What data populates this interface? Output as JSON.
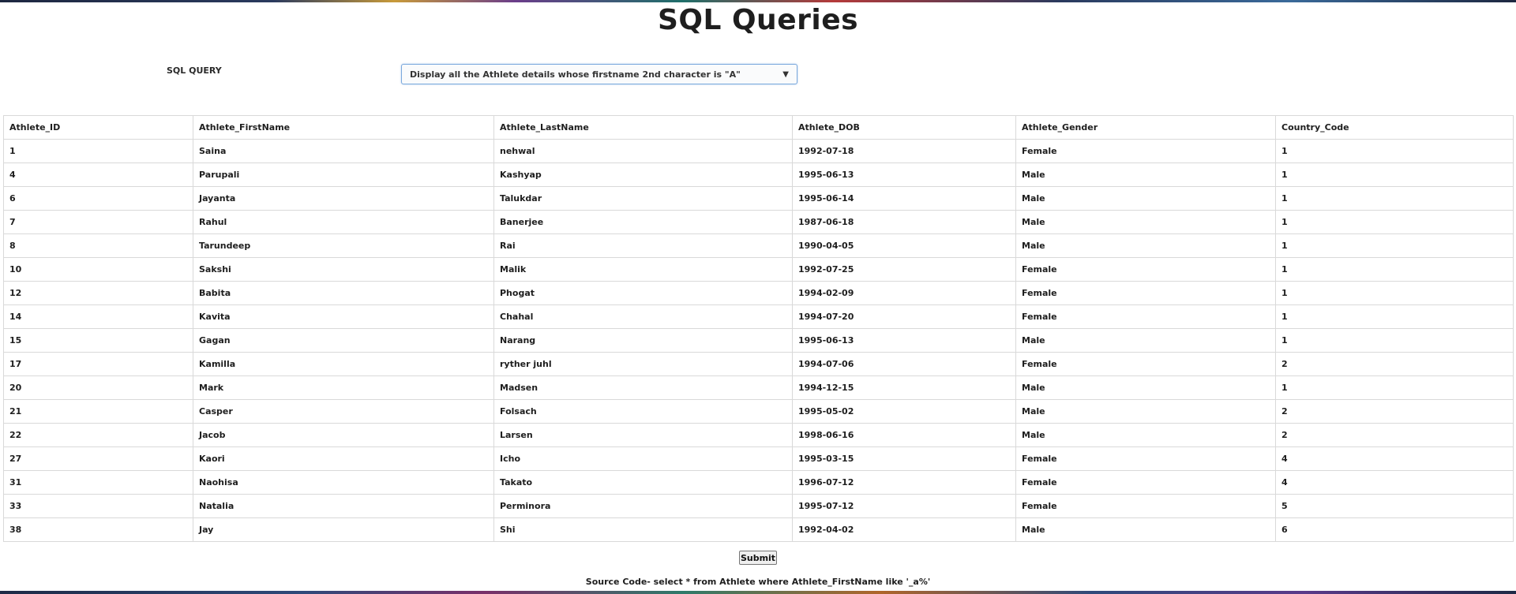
{
  "page": {
    "title": "SQL Queries"
  },
  "query": {
    "label": "SQL QUERY",
    "selected": "Display all the Athlete details whose firstname 2nd character is \"A\""
  },
  "table": {
    "columns": [
      "Athlete_ID",
      "Athlete_FirstName",
      "Athlete_LastName",
      "Athlete_DOB",
      "Athlete_Gender",
      "Country_Code"
    ],
    "rows": [
      [
        "1",
        "Saina",
        "nehwal",
        "1992-07-18",
        "Female",
        "1"
      ],
      [
        "4",
        "Parupali",
        "Kashyap",
        "1995-06-13",
        "Male",
        "1"
      ],
      [
        "6",
        "Jayanta",
        "Talukdar",
        "1995-06-14",
        "Male",
        "1"
      ],
      [
        "7",
        "Rahul",
        "Banerjee",
        "1987-06-18",
        "Male",
        "1"
      ],
      [
        "8",
        "Tarundeep",
        "Rai",
        "1990-04-05",
        "Male",
        "1"
      ],
      [
        "10",
        "Sakshi",
        "Malik",
        "1992-07-25",
        "Female",
        "1"
      ],
      [
        "12",
        "Babita",
        "Phogat",
        "1994-02-09",
        "Female",
        "1"
      ],
      [
        "14",
        "Kavita",
        "Chahal",
        "1994-07-20",
        "Female",
        "1"
      ],
      [
        "15",
        "Gagan",
        "Narang",
        "1995-06-13",
        "Male",
        "1"
      ],
      [
        "17",
        "Kamilla",
        "ryther juhl",
        "1994-07-06",
        "Female",
        "2"
      ],
      [
        "20",
        "Mark",
        "Madsen",
        "1994-12-15",
        "Male",
        "1"
      ],
      [
        "21",
        "Casper",
        "Folsach",
        "1995-05-02",
        "Male",
        "2"
      ],
      [
        "22",
        "Jacob",
        "Larsen",
        "1998-06-16",
        "Male",
        "2"
      ],
      [
        "27",
        "Kaori",
        "Icho",
        "1995-03-15",
        "Female",
        "4"
      ],
      [
        "31",
        "Naohisa",
        "Takato",
        "1996-07-12",
        "Female",
        "4"
      ],
      [
        "33",
        "Natalia",
        "Perminora",
        "1995-07-12",
        "Female",
        "5"
      ],
      [
        "38",
        "Jay",
        "Shi",
        "1992-04-02",
        "Male",
        "6"
      ]
    ]
  },
  "actions": {
    "submit_label": "Submit"
  },
  "footer": {
    "source_code": "Source Code- select * from Athlete where Athlete_FirstName like '_a%'"
  },
  "icons": {
    "dropdown": "caret-down-icon"
  },
  "colors": {
    "select_border": "#7ba9dd",
    "table_border": "#d9d9d9",
    "text": "#1e1e1e"
  }
}
